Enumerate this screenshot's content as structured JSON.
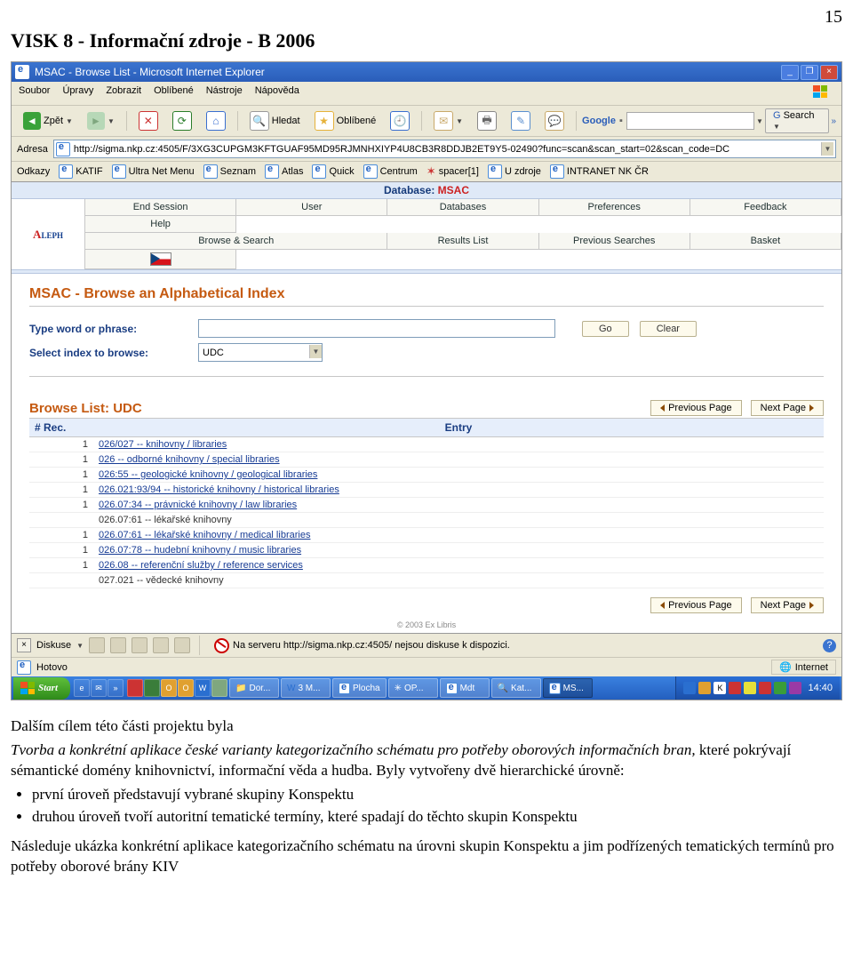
{
  "page_number": "15",
  "doc_title": "VISK 8 - Informační zdroje - B 2006",
  "ie": {
    "title": "MSAC - Browse List - Microsoft Internet Explorer",
    "menu": [
      "Soubor",
      "Úpravy",
      "Zobrazit",
      "Oblíbené",
      "Nástroje",
      "Nápověda"
    ],
    "toolbar": {
      "back": "Zpět",
      "search": "Hledat",
      "favorites": "Oblíbené"
    },
    "google_label": "Google",
    "google_search": "Search",
    "addr_label": "Adresa",
    "addr_value": "http://sigma.nkp.cz:4505/F/3XG3CUPGM3KFTGUAF95MD95RJMNHXIYP4U8CB3R8DDJB2ET9Y5-02490?func=scan&scan_start=02&scan_code=DC",
    "links_label": "Odkazy",
    "links": [
      "KATIF",
      "Ultra Net Menu",
      "Seznam",
      "Atlas",
      "Quick",
      "Centrum",
      "spacer[1]",
      "U zdroje",
      "INTRANET NK ČR"
    ]
  },
  "aleph": {
    "db_label": "Database:",
    "db_name": "MSAC",
    "row1": [
      "End Session",
      "User",
      "Databases",
      "Preferences",
      "Feedback",
      "Help"
    ],
    "row2": [
      "Browse & Search",
      "Results List",
      "Previous Searches",
      "Basket",
      ""
    ]
  },
  "msac": {
    "title": "MSAC - Browse an Alphabetical Index",
    "label_word": "Type word or phrase:",
    "label_index": "Select index to browse:",
    "index_value": "UDC",
    "btn_go": "Go",
    "btn_clear": "Clear"
  },
  "browse": {
    "title_prefix": "Browse List:  ",
    "title_value": "UDC",
    "rec_hdr": "# Rec.",
    "entry_hdr": "Entry",
    "prev": "Previous Page",
    "next": "Next Page",
    "rows": [
      {
        "n": "1",
        "entry": "026/027 -- knihovny / libraries",
        "link": true
      },
      {
        "n": "1",
        "entry": "026 -- odborné knihovny / special libraries",
        "link": true
      },
      {
        "n": "1",
        "entry": "026:55 -- geologické knihovny / geological libraries",
        "link": true
      },
      {
        "n": "1",
        "entry": "026.021:93/94 -- historické knihovny / historical libraries",
        "link": true
      },
      {
        "n": "1",
        "entry": "026.07:34 -- právnické knihovny / law libraries",
        "link": true
      },
      {
        "n": "",
        "entry": "026.07:61 -- lékařské knihovny",
        "link": false
      },
      {
        "n": "1",
        "entry": "026.07:61 -- lékařské knihovny / medical libraries",
        "link": true
      },
      {
        "n": "1",
        "entry": "026.07:78 -- hudební knihovny / music libraries",
        "link": true
      },
      {
        "n": "1",
        "entry": "026.08 -- referenční služby / reference services",
        "link": true
      },
      {
        "n": "",
        "entry": "027.021 -- vědecké knihovny",
        "link": false
      }
    ],
    "copyright": "© 2003 Ex Libris"
  },
  "discuss": {
    "label": "Diskuse",
    "msg": "Na serveru http://sigma.nkp.cz:4505/ nejsou diskuse k dispozici."
  },
  "status": {
    "ready": "Hotovo",
    "zone": "Internet"
  },
  "taskbar": {
    "start": "Start",
    "tasks": [
      "Dor...",
      "3 M...",
      "Plocha",
      "OP...",
      "Mdt",
      "Kat...",
      "MS..."
    ],
    "clock": "14:40"
  },
  "body_text": {
    "p1a": "Dalším cílem této části projektu byla",
    "p1b": "Tvorba a konkrétní aplikace  české varianty kategorizačního schématu pro potřeby oborových informačních bran,",
    "p1c": " které pokrývají sémantické domény knihovnictví, informační věda a hudba. Byly vytvořeny dvě hierarchické úrovně:",
    "li1": "první úroveň představují vybrané skupiny Konspektu",
    "li2": "druhou úroveň tvoří autoritní tematické termíny, které spadají do těchto skupin Konspektu",
    "p2": "Následuje ukázka konkrétní aplikace kategorizačního schématu na úrovni skupin Konspektu a jim podřízených tematických termínů pro potřeby oborové brány KIV"
  }
}
